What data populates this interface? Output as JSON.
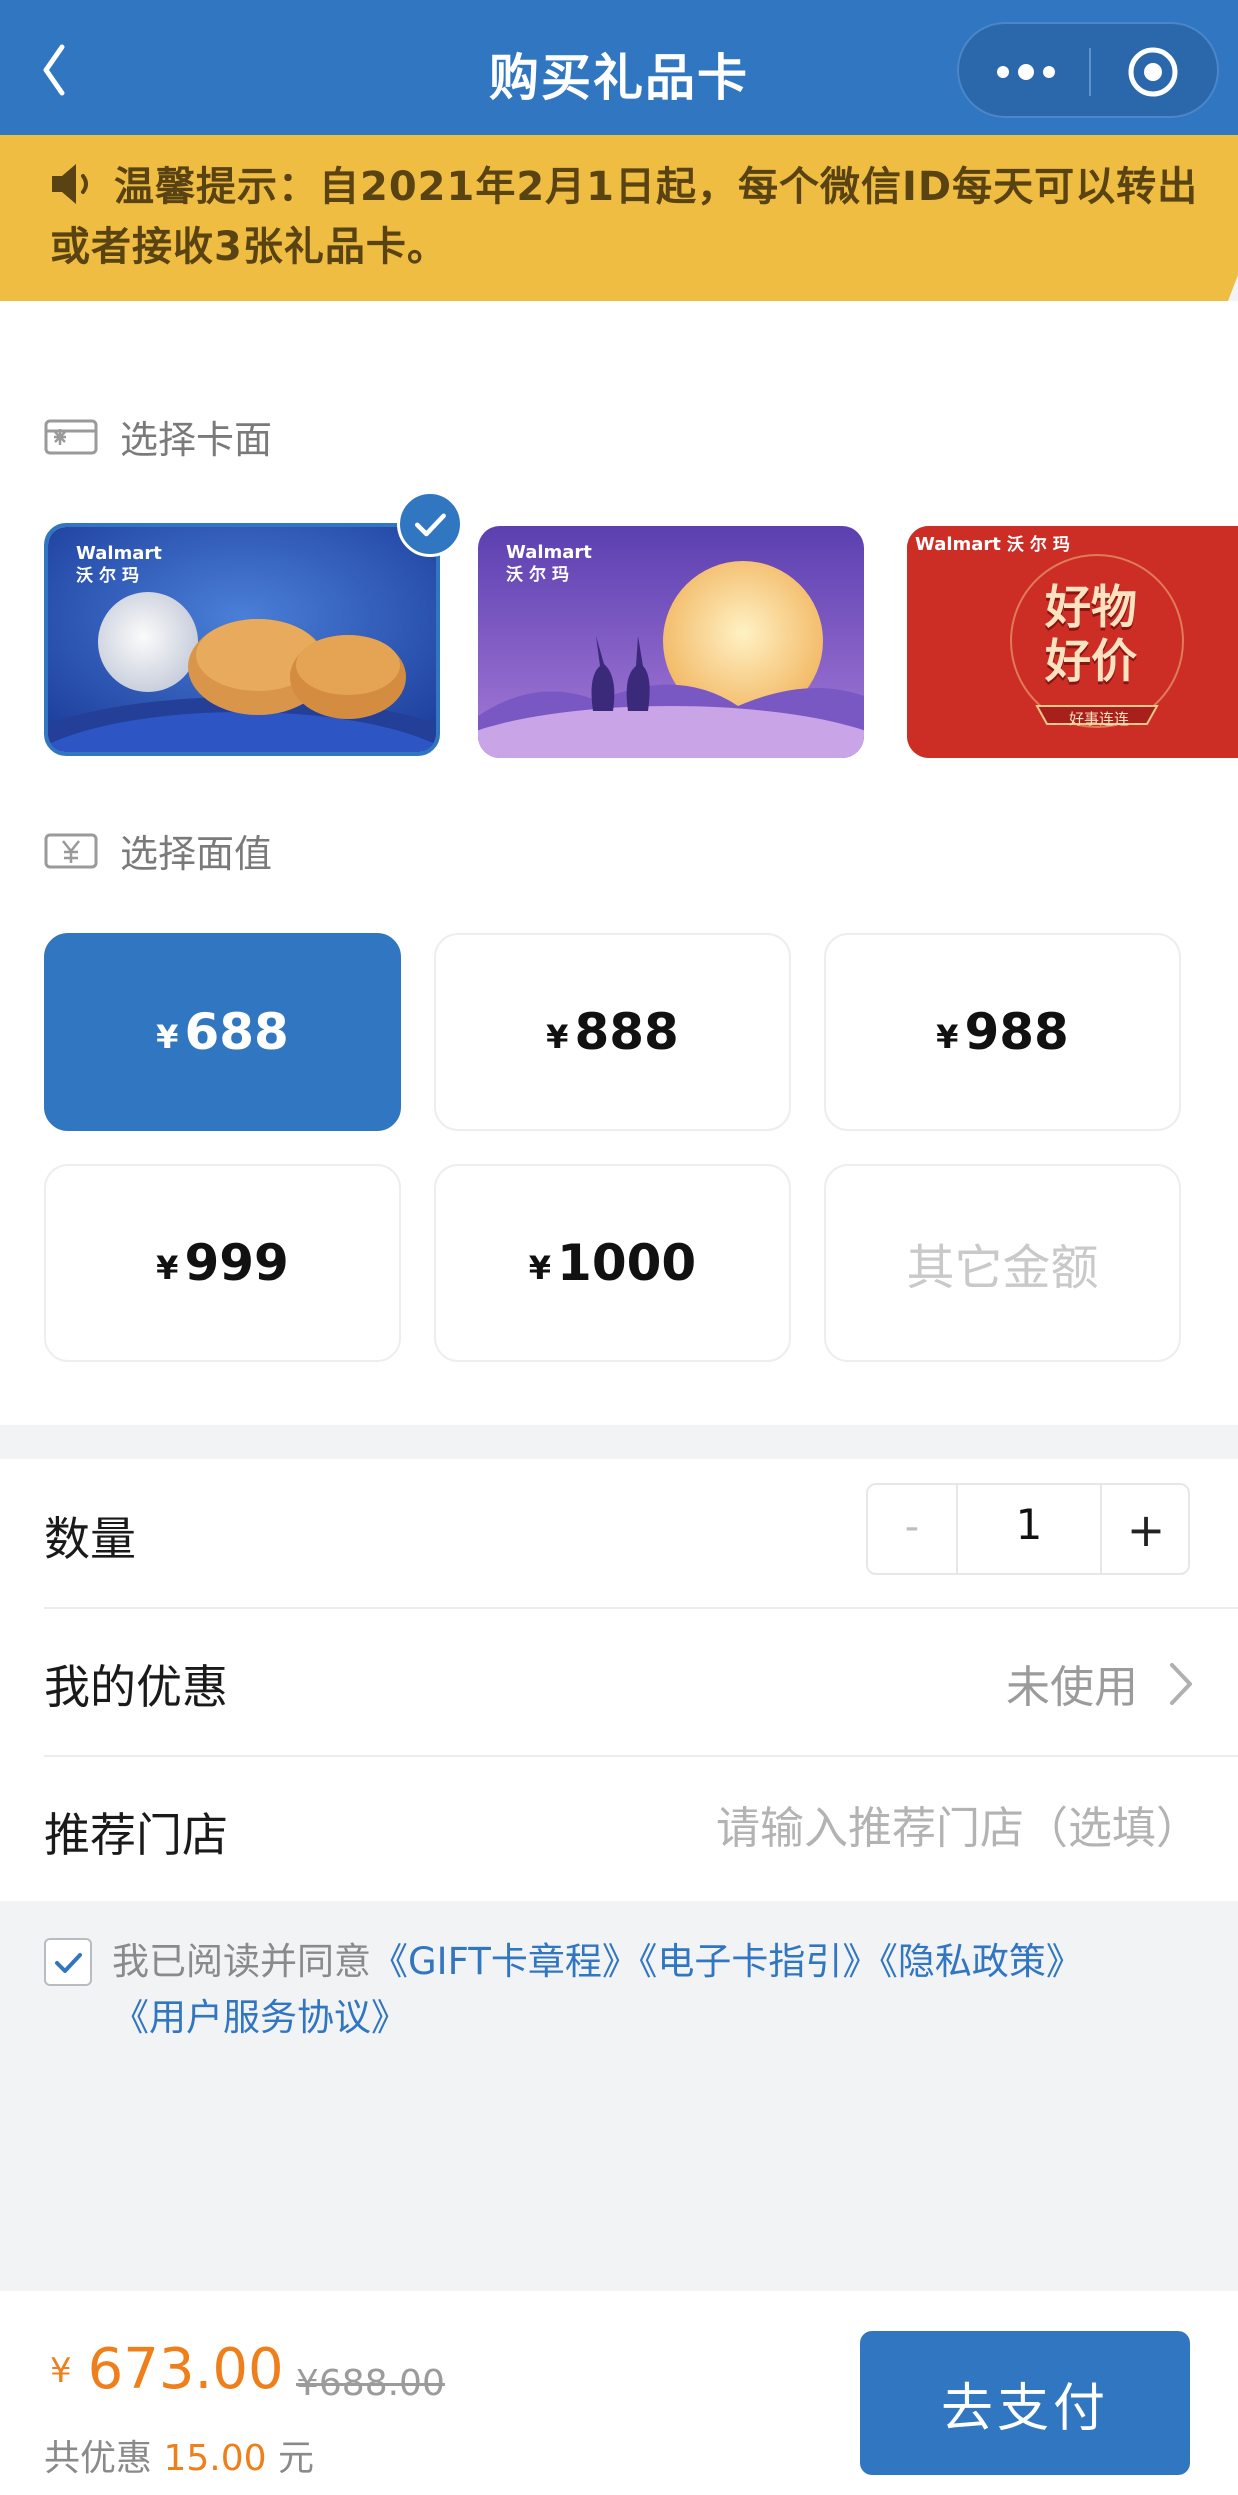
{
  "header": {
    "title": "购买礼品卡",
    "back_icon": "chevron-left-icon",
    "more_icon": "more-dots-icon",
    "close_icon": "target-circle-icon"
  },
  "notice": {
    "icon": "speaker-icon",
    "text": "温馨提示：自2021年2月1日起，每个微信ID每天可以转出或者接收3张礼品卡。"
  },
  "card_face": {
    "label": "选择卡面",
    "icon": "card-icon",
    "cards": [
      {
        "brand": "Walmart",
        "brand_cn": "沃尔玛",
        "theme": "mooncake-blue",
        "selected": true
      },
      {
        "brand": "Walmart",
        "brand_cn": "沃尔玛",
        "theme": "moon-rabbits-purple",
        "selected": false
      },
      {
        "brand": "Walmart",
        "brand_cn": "沃尔玛",
        "theme": "good-things-red",
        "art_text_1": "好物",
        "art_text_2": "好价",
        "art_sub": "好事连连",
        "selected": false
      }
    ]
  },
  "denomination": {
    "label": "选择面值",
    "icon": "yen-box-icon",
    "currency": "¥",
    "options": [
      {
        "value": "688",
        "selected": true
      },
      {
        "value": "888",
        "selected": false
      },
      {
        "value": "988",
        "selected": false
      },
      {
        "value": "999",
        "selected": false
      },
      {
        "value": "1000",
        "selected": false
      }
    ],
    "other_label": "其它金额"
  },
  "quantity": {
    "label": "数量",
    "minus": "-",
    "value": "1",
    "plus": "+"
  },
  "coupon": {
    "label": "我的优惠",
    "value": "未使用"
  },
  "store": {
    "label": "推荐门店",
    "placeholder": "请输入推荐门店（选填）"
  },
  "agreement": {
    "checked": true,
    "prefix": "我已阅读并同意",
    "links": [
      "《GIFT卡章程》",
      "《电子卡指引》",
      "《隐私政策》",
      "《用户服务协议》"
    ]
  },
  "footer": {
    "currency": "¥",
    "price": "673.00",
    "original_price": "¥688.00",
    "saving_prefix": "共优惠",
    "saving_amount": "15.00",
    "saving_suffix": "元",
    "pay_label": "去支付"
  },
  "colors": {
    "primary": "#3176c1",
    "notice_bg": "#f0bd43",
    "price": "#ef7f1a"
  }
}
